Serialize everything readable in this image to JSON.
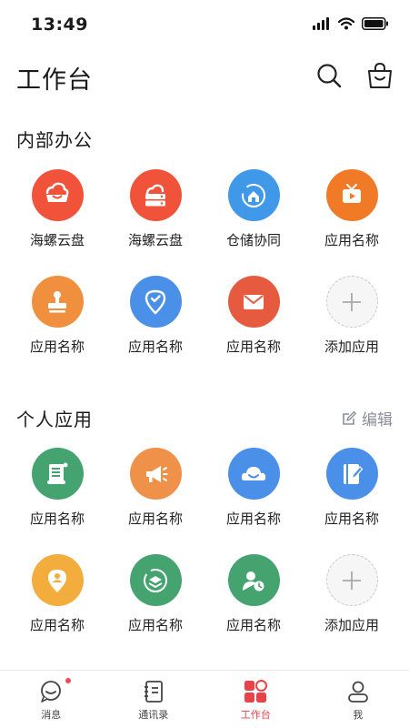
{
  "status": {
    "time": "13:49"
  },
  "header": {
    "title": "工作台"
  },
  "sections": {
    "internal": {
      "title": "内部办公",
      "apps": [
        {
          "label": "海螺云盘",
          "color": "#f0533a",
          "icon": "cloud-tray-icon"
        },
        {
          "label": "海螺云盘",
          "color": "#f0533a",
          "icon": "cloud-server-icon"
        },
        {
          "label": "仓储协同",
          "color": "#3f98e8",
          "icon": "warehouse-icon"
        },
        {
          "label": "应用名称",
          "color": "#f07a26",
          "icon": "tv-play-icon"
        },
        {
          "label": "应用名称",
          "color": "#f0903e",
          "icon": "stamp-icon"
        },
        {
          "label": "应用名称",
          "color": "#4a8fe8",
          "icon": "location-check-icon"
        },
        {
          "label": "应用名称",
          "color": "#e65a3f",
          "icon": "mail-icon"
        },
        {
          "label": "添加应用",
          "color": "#f6f6f6",
          "icon": "plus-icon"
        }
      ]
    },
    "personal": {
      "title": "个人应用",
      "edit_label": "编辑",
      "apps": [
        {
          "label": "应用名称",
          "color": "#44a36f",
          "icon": "scroll-icon"
        },
        {
          "label": "应用名称",
          "color": "#f0914a",
          "icon": "megaphone-icon"
        },
        {
          "label": "应用名称",
          "color": "#4a8fe8",
          "icon": "smile-cloud-icon"
        },
        {
          "label": "应用名称",
          "color": "#4a8fe8",
          "icon": "notebook-pen-icon"
        },
        {
          "label": "应用名称",
          "color": "#f3ad3c",
          "icon": "location-person-icon"
        },
        {
          "label": "应用名称",
          "color": "#44a36f",
          "icon": "layers-icon"
        },
        {
          "label": "应用名称",
          "color": "#44a36f",
          "icon": "contact-clock-icon"
        },
        {
          "label": "添加应用",
          "color": "#f6f6f6",
          "icon": "plus-icon"
        }
      ]
    }
  },
  "tabs": [
    {
      "label": "消息",
      "icon": "chat-bubble-icon"
    },
    {
      "label": "通讯录",
      "icon": "address-book-icon"
    },
    {
      "label": "工作台",
      "icon": "workbench-grid-icon",
      "active_color": "#e9434a"
    },
    {
      "label": "我",
      "icon": "user-icon"
    }
  ]
}
